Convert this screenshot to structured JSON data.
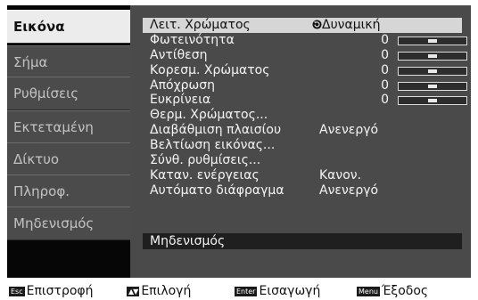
{
  "sidebar": {
    "tabs": [
      {
        "label": "Εικόνα",
        "active": true
      },
      {
        "label": "Σήμα",
        "active": false
      },
      {
        "label": "Ρυθμίσεις",
        "active": false
      },
      {
        "label": "Εκτεταμένη",
        "active": false
      },
      {
        "label": "Δίκτυο",
        "active": false
      },
      {
        "label": "Πληροφ.",
        "active": false
      },
      {
        "label": "Μηδενισμός",
        "active": false
      }
    ]
  },
  "menu": {
    "items": [
      {
        "label": "Λειτ. Χρώματος",
        "value": "Δυναμική",
        "value_icon": "refresh-icon"
      },
      {
        "label": "Φωτεινότητα",
        "value": "0",
        "slider_level": 0.5
      },
      {
        "label": "Αντίθεση",
        "value": "0",
        "slider_level": 0.5
      },
      {
        "label": "Κορεσμ. Χρώματος",
        "value": "0",
        "slider_level": 0.5
      },
      {
        "label": "Απόχρωση",
        "value": "0",
        "slider_level": 0.5
      },
      {
        "label": "Ευκρίνεια",
        "value": "0",
        "slider_level": 0.5
      },
      {
        "label": "Θερμ. Χρώματος..."
      },
      {
        "label": "Διαβάθμιση πλαισίου",
        "value": "Ανενεργό"
      },
      {
        "label": "Βελτίωση εικόνας..."
      },
      {
        "label": "Σύνθ. ρυθμίσεις..."
      },
      {
        "label": "Καταν. ενέργειας",
        "value": "Κανον."
      },
      {
        "label": "Αυτόματο διάφραγμα",
        "value": "Ανενεργό"
      }
    ],
    "reset_label": "Μηδενισμός"
  },
  "footer": {
    "back": {
      "key": "Esc",
      "label": "Επιστροφή"
    },
    "select": {
      "key": "▲▼",
      "label": "Επιλογή"
    },
    "enter": {
      "key": "Enter",
      "label": "Εισαγωγή"
    },
    "exit": {
      "key": "Menu",
      "label": "Έξοδος"
    }
  },
  "colors": {
    "menu_background": "#4a4a4a",
    "selected_row": "#d6d6d6",
    "active_tab": "#ececec",
    "inactive_tab": "#4b4b4b"
  }
}
